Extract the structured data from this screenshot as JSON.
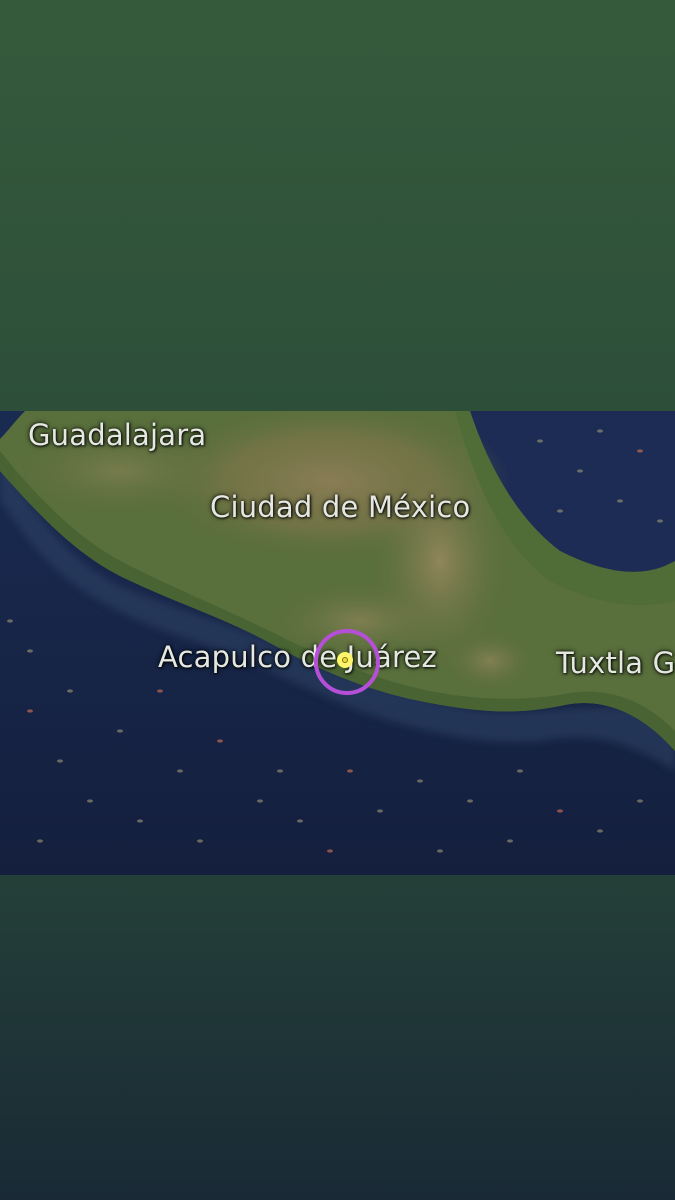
{
  "map": {
    "labels": {
      "guadalajara": "Guadalajara",
      "mexico_city": "Ciudad de México",
      "acapulco": "Acapulco de Juárez",
      "tuxtla": "Tuxtla G"
    },
    "marker": {
      "location": "Acapulco de Juárez",
      "ring_color": "#b54fd8",
      "dot_color": "#fff56a"
    },
    "colors": {
      "ocean": "#17274a",
      "land": "#596f3c",
      "highlands": "#8a7d55",
      "background_top": "#355a3b",
      "background_bottom": "#192a36"
    }
  }
}
